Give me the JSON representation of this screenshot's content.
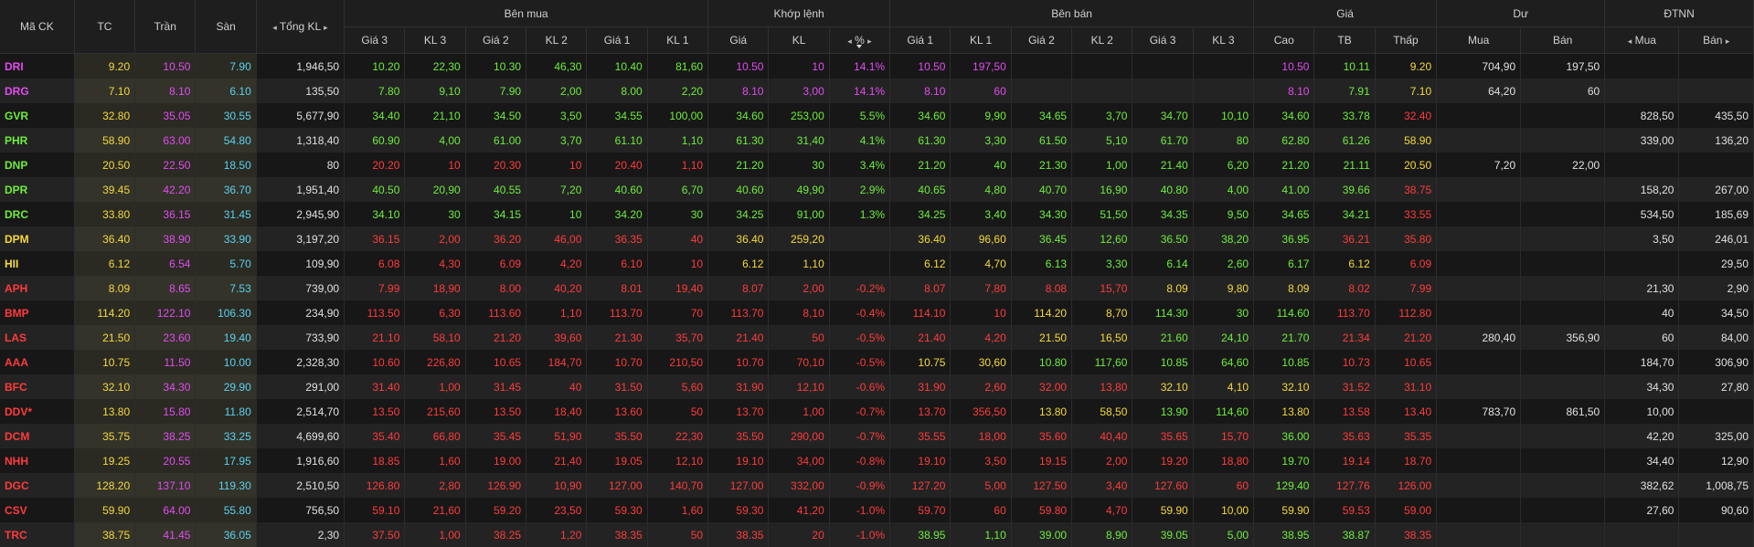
{
  "colors": {
    "up": "#6eed3c",
    "down": "#ff3b3b",
    "ref": "#f5d93b",
    "ceil": "#e24cf2",
    "floor": "#5ad2f0"
  },
  "header": {
    "symbol": "Mã CK",
    "ref": "TC",
    "ceil": "Trần",
    "floor": "Sàn",
    "total_vol": "Tổng KL",
    "buy_group": "Bên mua",
    "match_group": "Khớp lệnh",
    "sell_group": "Bên bán",
    "price_group": "Giá",
    "res_group": "Dư",
    "foreign_group": "ĐTNN",
    "p3": "Giá 3",
    "v3": "KL 3",
    "p2": "Giá 2",
    "v2": "KL 2",
    "p1": "Giá 1",
    "v1": "KL 1",
    "m_price": "Giá",
    "m_vol": "KL",
    "m_pct": "%",
    "high": "Cao",
    "avg": "TB",
    "low": "Thấp",
    "res_buy": "Mua",
    "res_sell": "Bán",
    "f_buy": "Mua",
    "f_sell": "Bán",
    "arrow_left": "◂",
    "arrow_right": "▸"
  },
  "rows": [
    {
      "sym": [
        "DRI",
        "ce"
      ],
      "tc": "9.20",
      "tran": "10.50",
      "san": "7.90",
      "tkl": "1,946,50",
      "b3": [
        "10.20",
        "up"
      ],
      "bv3": "22,30",
      "b2": [
        "10.30",
        "up"
      ],
      "bv2": "46,30",
      "b1": [
        "10.40",
        "up"
      ],
      "bv1": "81,60",
      "mp": [
        "10.50",
        "ce"
      ],
      "mv": "10",
      "pct": "14.1%",
      "s1": [
        "10.50",
        "ce"
      ],
      "sv1": "197,50",
      "s2": [
        "",
        ""
      ],
      "sv2": "",
      "s3": [
        "",
        ""
      ],
      "sv3": "",
      "hi": [
        "10.50",
        "ce"
      ],
      "av": [
        "10.11",
        "up"
      ],
      "lo": [
        "9.20",
        "ref"
      ],
      "rb": "704,90",
      "rs": "197,50",
      "fb": "",
      "fs": ""
    },
    {
      "sym": [
        "DRG",
        "ce"
      ],
      "tc": "7.10",
      "tran": "8.10",
      "san": "6.10",
      "tkl": "135,50",
      "b3": [
        "7.80",
        "up"
      ],
      "bv3": "9,10",
      "b2": [
        "7.90",
        "up"
      ],
      "bv2": "2,00",
      "b1": [
        "8.00",
        "up"
      ],
      "bv1": "2,20",
      "mp": [
        "8.10",
        "ce"
      ],
      "mv": "3,00",
      "pct": "14.1%",
      "s1": [
        "8.10",
        "ce"
      ],
      "sv1": "60",
      "s2": [
        "",
        ""
      ],
      "sv2": "",
      "s3": [
        "",
        ""
      ],
      "sv3": "",
      "hi": [
        "8.10",
        "ce"
      ],
      "av": [
        "7.91",
        "up"
      ],
      "lo": [
        "7.10",
        "ref"
      ],
      "rb": "64,20",
      "rs": "60",
      "fb": "",
      "fs": ""
    },
    {
      "sym": [
        "GVR",
        "up"
      ],
      "tc": "32.80",
      "tran": "35.05",
      "san": "30.55",
      "tkl": "5,677,90",
      "b3": [
        "34.40",
        "up"
      ],
      "bv3": "21,10",
      "b2": [
        "34.50",
        "up"
      ],
      "bv2": "3,50",
      "b1": [
        "34.55",
        "up"
      ],
      "bv1": "100,00",
      "mp": [
        "34.60",
        "up"
      ],
      "mv": "253,00",
      "pct": "5.5%",
      "s1": [
        "34.60",
        "up"
      ],
      "sv1": "9,90",
      "s2": [
        "34.65",
        "up"
      ],
      "sv2": "3,70",
      "s3": [
        "34.70",
        "up"
      ],
      "sv3": "10,10",
      "hi": [
        "34.60",
        "up"
      ],
      "av": [
        "33.78",
        "up"
      ],
      "lo": [
        "32.40",
        "dn"
      ],
      "rb": "",
      "rs": "",
      "fb": "828,50",
      "fs": "435,50"
    },
    {
      "sym": [
        "PHR",
        "up"
      ],
      "tc": "58.90",
      "tran": "63.00",
      "san": "54.80",
      "tkl": "1,318,40",
      "b3": [
        "60.90",
        "up"
      ],
      "bv3": "4,00",
      "b2": [
        "61.00",
        "up"
      ],
      "bv2": "3,70",
      "b1": [
        "61.10",
        "up"
      ],
      "bv1": "1,10",
      "mp": [
        "61.30",
        "up"
      ],
      "mv": "31,40",
      "pct": "4.1%",
      "s1": [
        "61.30",
        "up"
      ],
      "sv1": "3,30",
      "s2": [
        "61.50",
        "up"
      ],
      "sv2": "5,10",
      "s3": [
        "61.70",
        "up"
      ],
      "sv3": "80",
      "hi": [
        "62.80",
        "up"
      ],
      "av": [
        "61.26",
        "up"
      ],
      "lo": [
        "58.90",
        "ref"
      ],
      "rb": "",
      "rs": "",
      "fb": "339,00",
      "fs": "136,20"
    },
    {
      "sym": [
        "DNP",
        "up"
      ],
      "tc": "20.50",
      "tran": "22.50",
      "san": "18.50",
      "tkl": "80",
      "b3": [
        "20.20",
        "dn"
      ],
      "bv3": "10",
      "b2": [
        "20.30",
        "dn"
      ],
      "bv2": "10",
      "b1": [
        "20.40",
        "dn"
      ],
      "bv1": "1,10",
      "mp": [
        "21.20",
        "up"
      ],
      "mv": "30",
      "pct": "3.4%",
      "s1": [
        "21.20",
        "up"
      ],
      "sv1": "40",
      "s2": [
        "21.30",
        "up"
      ],
      "sv2": "1,00",
      "s3": [
        "21.40",
        "up"
      ],
      "sv3": "6,20",
      "hi": [
        "21.20",
        "up"
      ],
      "av": [
        "21.11",
        "up"
      ],
      "lo": [
        "20.50",
        "ref"
      ],
      "rb": "7,20",
      "rs": "22,00",
      "fb": "",
      "fs": ""
    },
    {
      "sym": [
        "DPR",
        "up"
      ],
      "tc": "39.45",
      "tran": "42.20",
      "san": "36.70",
      "tkl": "1,951,40",
      "b3": [
        "40.50",
        "up"
      ],
      "bv3": "20,90",
      "b2": [
        "40.55",
        "up"
      ],
      "bv2": "7,20",
      "b1": [
        "40.60",
        "up"
      ],
      "bv1": "6,70",
      "mp": [
        "40.60",
        "up"
      ],
      "mv": "49,90",
      "pct": "2.9%",
      "s1": [
        "40.65",
        "up"
      ],
      "sv1": "4,80",
      "s2": [
        "40.70",
        "up"
      ],
      "sv2": "16,90",
      "s3": [
        "40.80",
        "up"
      ],
      "sv3": "4,00",
      "hi": [
        "41.00",
        "up"
      ],
      "av": [
        "39.66",
        "up"
      ],
      "lo": [
        "38.75",
        "dn"
      ],
      "rb": "",
      "rs": "",
      "fb": "158,20",
      "fs": "267,00"
    },
    {
      "sym": [
        "DRC",
        "up"
      ],
      "tc": "33.80",
      "tran": "36.15",
      "san": "31.45",
      "tkl": "2,945,90",
      "b3": [
        "34.10",
        "up"
      ],
      "bv3": "30",
      "b2": [
        "34.15",
        "up"
      ],
      "bv2": "10",
      "b1": [
        "34.20",
        "up"
      ],
      "bv1": "30",
      "mp": [
        "34.25",
        "up"
      ],
      "mv": "91,00",
      "pct": "1.3%",
      "s1": [
        "34.25",
        "up"
      ],
      "sv1": "3,40",
      "s2": [
        "34.30",
        "up"
      ],
      "sv2": "51,50",
      "s3": [
        "34.35",
        "up"
      ],
      "sv3": "9,50",
      "hi": [
        "34.65",
        "up"
      ],
      "av": [
        "34.21",
        "up"
      ],
      "lo": [
        "33.55",
        "dn"
      ],
      "rb": "",
      "rs": "",
      "fb": "534,50",
      "fs": "185,69"
    },
    {
      "sym": [
        "DPM",
        "ref"
      ],
      "tc": "36.40",
      "tran": "38.90",
      "san": "33.90",
      "tkl": "3,197,20",
      "b3": [
        "36.15",
        "dn"
      ],
      "bv3": "2,00",
      "b2": [
        "36.20",
        "dn"
      ],
      "bv2": "46,00",
      "b1": [
        "36.35",
        "dn"
      ],
      "bv1": "40",
      "mp": [
        "36.40",
        "ref"
      ],
      "mv": "259,20",
      "pct": "",
      "s1": [
        "36.40",
        "ref"
      ],
      "sv1": "96,60",
      "s2": [
        "36.45",
        "up"
      ],
      "sv2": "12,60",
      "s3": [
        "36.50",
        "up"
      ],
      "sv3": "38,20",
      "hi": [
        "36.95",
        "up"
      ],
      "av": [
        "36.21",
        "dn"
      ],
      "lo": [
        "35.80",
        "dn"
      ],
      "rb": "",
      "rs": "",
      "fb": "3,50",
      "fs": "246,01"
    },
    {
      "sym": [
        "HII",
        "ref"
      ],
      "tc": "6.12",
      "tran": "6.54",
      "san": "5.70",
      "tkl": "109,90",
      "b3": [
        "6.08",
        "dn"
      ],
      "bv3": "4,30",
      "b2": [
        "6.09",
        "dn"
      ],
      "bv2": "4,20",
      "b1": [
        "6.10",
        "dn"
      ],
      "bv1": "10",
      "mp": [
        "6.12",
        "ref"
      ],
      "mv": "1,10",
      "pct": "",
      "s1": [
        "6.12",
        "ref"
      ],
      "sv1": "4,70",
      "s2": [
        "6.13",
        "up"
      ],
      "sv2": "3,30",
      "s3": [
        "6.14",
        "up"
      ],
      "sv3": "2,60",
      "hi": [
        "6.17",
        "up"
      ],
      "av": [
        "6.12",
        "ref"
      ],
      "lo": [
        "6.09",
        "dn"
      ],
      "rb": "",
      "rs": "",
      "fb": "",
      "fs": "29,50"
    },
    {
      "sym": [
        "APH",
        "dn"
      ],
      "tc": "8.09",
      "tran": "8.65",
      "san": "7.53",
      "tkl": "739,00",
      "b3": [
        "7.99",
        "dn"
      ],
      "bv3": "18,90",
      "b2": [
        "8.00",
        "dn"
      ],
      "bv2": "40,20",
      "b1": [
        "8.01",
        "dn"
      ],
      "bv1": "19,40",
      "mp": [
        "8.07",
        "dn"
      ],
      "mv": "2,00",
      "pct": "-0.2%",
      "s1": [
        "8.07",
        "dn"
      ],
      "sv1": "7,80",
      "s2": [
        "8.08",
        "dn"
      ],
      "sv2": "15,70",
      "s3": [
        "8.09",
        "ref"
      ],
      "sv3": "9,80",
      "hi": [
        "8.09",
        "ref"
      ],
      "av": [
        "8.02",
        "dn"
      ],
      "lo": [
        "7.99",
        "dn"
      ],
      "rb": "",
      "rs": "",
      "fb": "21,30",
      "fs": "2,90"
    },
    {
      "sym": [
        "BMP",
        "dn"
      ],
      "tc": "114.20",
      "tran": "122.10",
      "san": "106.30",
      "tkl": "234,90",
      "b3": [
        "113.50",
        "dn"
      ],
      "bv3": "6,30",
      "b2": [
        "113.60",
        "dn"
      ],
      "bv2": "1,10",
      "b1": [
        "113.70",
        "dn"
      ],
      "bv1": "70",
      "mp": [
        "113.70",
        "dn"
      ],
      "mv": "8,10",
      "pct": "-0.4%",
      "s1": [
        "114.10",
        "dn"
      ],
      "sv1": "10",
      "s2": [
        "114.20",
        "ref"
      ],
      "sv2": "8,70",
      "s3": [
        "114.30",
        "up"
      ],
      "sv3": "30",
      "hi": [
        "114.60",
        "up"
      ],
      "av": [
        "113.70",
        "dn"
      ],
      "lo": [
        "112.80",
        "dn"
      ],
      "rb": "",
      "rs": "",
      "fb": "40",
      "fs": "34,50"
    },
    {
      "sym": [
        "LAS",
        "dn"
      ],
      "tc": "21.50",
      "tran": "23.60",
      "san": "19.40",
      "tkl": "733,90",
      "b3": [
        "21.10",
        "dn"
      ],
      "bv3": "58,10",
      "b2": [
        "21.20",
        "dn"
      ],
      "bv2": "39,60",
      "b1": [
        "21.30",
        "dn"
      ],
      "bv1": "35,70",
      "mp": [
        "21.40",
        "dn"
      ],
      "mv": "50",
      "pct": "-0.5%",
      "s1": [
        "21.40",
        "dn"
      ],
      "sv1": "4,20",
      "s2": [
        "21.50",
        "ref"
      ],
      "sv2": "16,50",
      "s3": [
        "21.60",
        "up"
      ],
      "sv3": "24,10",
      "hi": [
        "21.70",
        "up"
      ],
      "av": [
        "21.34",
        "dn"
      ],
      "lo": [
        "21.20",
        "dn"
      ],
      "rb": "280,40",
      "rs": "356,90",
      "fb": "60",
      "fs": "84,00"
    },
    {
      "sym": [
        "AAA",
        "dn"
      ],
      "tc": "10.75",
      "tran": "11.50",
      "san": "10.00",
      "tkl": "2,328,30",
      "b3": [
        "10.60",
        "dn"
      ],
      "bv3": "226,80",
      "b2": [
        "10.65",
        "dn"
      ],
      "bv2": "184,70",
      "b1": [
        "10.70",
        "dn"
      ],
      "bv1": "210,50",
      "mp": [
        "10.70",
        "dn"
      ],
      "mv": "70,10",
      "pct": "-0.5%",
      "s1": [
        "10.75",
        "ref"
      ],
      "sv1": "30,60",
      "s2": [
        "10.80",
        "up"
      ],
      "sv2": "117,60",
      "s3": [
        "10.85",
        "up"
      ],
      "sv3": "64,60",
      "hi": [
        "10.85",
        "up"
      ],
      "av": [
        "10.73",
        "dn"
      ],
      "lo": [
        "10.65",
        "dn"
      ],
      "rb": "",
      "rs": "",
      "fb": "184,70",
      "fs": "306,90"
    },
    {
      "sym": [
        "BFC",
        "dn"
      ],
      "tc": "32.10",
      "tran": "34.30",
      "san": "29.90",
      "tkl": "291,00",
      "b3": [
        "31.40",
        "dn"
      ],
      "bv3": "1,00",
      "b2": [
        "31.45",
        "dn"
      ],
      "bv2": "40",
      "b1": [
        "31.50",
        "dn"
      ],
      "bv1": "5,60",
      "mp": [
        "31.90",
        "dn"
      ],
      "mv": "12,10",
      "pct": "-0.6%",
      "s1": [
        "31.90",
        "dn"
      ],
      "sv1": "2,60",
      "s2": [
        "32.00",
        "dn"
      ],
      "sv2": "13,80",
      "s3": [
        "32.10",
        "ref"
      ],
      "sv3": "4,10",
      "hi": [
        "32.10",
        "ref"
      ],
      "av": [
        "31.52",
        "dn"
      ],
      "lo": [
        "31.10",
        "dn"
      ],
      "rb": "",
      "rs": "",
      "fb": "34,30",
      "fs": "27,80"
    },
    {
      "sym": [
        "DDV*",
        "dn"
      ],
      "tc": "13.80",
      "tran": "15.80",
      "san": "11.80",
      "tkl": "2,514,70",
      "b3": [
        "13.50",
        "dn"
      ],
      "bv3": "215,60",
      "b2": [
        "13.50",
        "dn"
      ],
      "bv2": "18,40",
      "b1": [
        "13.60",
        "dn"
      ],
      "bv1": "50",
      "mp": [
        "13.70",
        "dn"
      ],
      "mv": "1,00",
      "pct": "-0.7%",
      "s1": [
        "13.70",
        "dn"
      ],
      "sv1": "356,50",
      "s2": [
        "13.80",
        "ref"
      ],
      "sv2": "58,50",
      "s3": [
        "13.90",
        "up"
      ],
      "sv3": "114,60",
      "hi": [
        "13.80",
        "ref"
      ],
      "av": [
        "13.58",
        "dn"
      ],
      "lo": [
        "13.40",
        "dn"
      ],
      "rb": "783,70",
      "rs": "861,50",
      "fb": "10,00",
      "fs": ""
    },
    {
      "sym": [
        "DCM",
        "dn"
      ],
      "tc": "35.75",
      "tran": "38.25",
      "san": "33.25",
      "tkl": "4,699,60",
      "b3": [
        "35.40",
        "dn"
      ],
      "bv3": "66,80",
      "b2": [
        "35.45",
        "dn"
      ],
      "bv2": "51,90",
      "b1": [
        "35.50",
        "dn"
      ],
      "bv1": "22,30",
      "mp": [
        "35.50",
        "dn"
      ],
      "mv": "290,00",
      "pct": "-0.7%",
      "s1": [
        "35.55",
        "dn"
      ],
      "sv1": "18,00",
      "s2": [
        "35.60",
        "dn"
      ],
      "sv2": "40,40",
      "s3": [
        "35.65",
        "dn"
      ],
      "sv3": "15,70",
      "hi": [
        "36.00",
        "up"
      ],
      "av": [
        "35.63",
        "dn"
      ],
      "lo": [
        "35.35",
        "dn"
      ],
      "rb": "",
      "rs": "",
      "fb": "42,20",
      "fs": "325,00"
    },
    {
      "sym": [
        "NHH",
        "dn"
      ],
      "tc": "19.25",
      "tran": "20.55",
      "san": "17.95",
      "tkl": "1,916,60",
      "b3": [
        "18.85",
        "dn"
      ],
      "bv3": "1,60",
      "b2": [
        "19.00",
        "dn"
      ],
      "bv2": "21,40",
      "b1": [
        "19.05",
        "dn"
      ],
      "bv1": "12,10",
      "mp": [
        "19.10",
        "dn"
      ],
      "mv": "34,00",
      "pct": "-0.8%",
      "s1": [
        "19.10",
        "dn"
      ],
      "sv1": "3,50",
      "s2": [
        "19.15",
        "dn"
      ],
      "sv2": "2,00",
      "s3": [
        "19.20",
        "dn"
      ],
      "sv3": "18,80",
      "hi": [
        "19.70",
        "up"
      ],
      "av": [
        "19.14",
        "dn"
      ],
      "lo": [
        "18.70",
        "dn"
      ],
      "rb": "",
      "rs": "",
      "fb": "34,40",
      "fs": "12,90"
    },
    {
      "sym": [
        "DGC",
        "dn"
      ],
      "tc": "128.20",
      "tran": "137.10",
      "san": "119.30",
      "tkl": "2,510,50",
      "b3": [
        "126.80",
        "dn"
      ],
      "bv3": "2,80",
      "b2": [
        "126.90",
        "dn"
      ],
      "bv2": "10,90",
      "b1": [
        "127.00",
        "dn"
      ],
      "bv1": "140,70",
      "mp": [
        "127.00",
        "dn"
      ],
      "mv": "332,00",
      "pct": "-0.9%",
      "s1": [
        "127.20",
        "dn"
      ],
      "sv1": "5,00",
      "s2": [
        "127.50",
        "dn"
      ],
      "sv2": "3,40",
      "s3": [
        "127.60",
        "dn"
      ],
      "sv3": "60",
      "hi": [
        "129.40",
        "up"
      ],
      "av": [
        "127.76",
        "dn"
      ],
      "lo": [
        "126.00",
        "dn"
      ],
      "rb": "",
      "rs": "",
      "fb": "382,62",
      "fs": "1,008,75"
    },
    {
      "sym": [
        "CSV",
        "dn"
      ],
      "tc": "59.90",
      "tran": "64.00",
      "san": "55.80",
      "tkl": "756,50",
      "b3": [
        "59.10",
        "dn"
      ],
      "bv3": "21,60",
      "b2": [
        "59.20",
        "dn"
      ],
      "bv2": "23,50",
      "b1": [
        "59.30",
        "dn"
      ],
      "bv1": "1,60",
      "mp": [
        "59.30",
        "dn"
      ],
      "mv": "41,20",
      "pct": "-1.0%",
      "s1": [
        "59.70",
        "dn"
      ],
      "sv1": "60",
      "s2": [
        "59.80",
        "dn"
      ],
      "sv2": "4,70",
      "s3": [
        "59.90",
        "ref"
      ],
      "sv3": "10,00",
      "hi": [
        "59.90",
        "ref"
      ],
      "av": [
        "59.53",
        "dn"
      ],
      "lo": [
        "59.00",
        "dn"
      ],
      "rb": "",
      "rs": "",
      "fb": "27,60",
      "fs": "90,60"
    },
    {
      "sym": [
        "TRC",
        "dn"
      ],
      "tc": "38.75",
      "tran": "41.45",
      "san": "36.05",
      "tkl": "2,30",
      "b3": [
        "37.50",
        "dn"
      ],
      "bv3": "1,00",
      "b2": [
        "38.25",
        "dn"
      ],
      "bv2": "1,20",
      "b1": [
        "38.35",
        "dn"
      ],
      "bv1": "50",
      "mp": [
        "38.35",
        "dn"
      ],
      "mv": "20",
      "pct": "-1.0%",
      "s1": [
        "38.95",
        "up"
      ],
      "sv1": "1,10",
      "s2": [
        "39.00",
        "up"
      ],
      "sv2": "8,90",
      "s3": [
        "39.05",
        "up"
      ],
      "sv3": "5,00",
      "hi": [
        "38.95",
        "up"
      ],
      "av": [
        "38.87",
        "up"
      ],
      "lo": [
        "38.35",
        "dn"
      ],
      "rb": "",
      "rs": "",
      "fb": "",
      "fs": ""
    }
  ]
}
